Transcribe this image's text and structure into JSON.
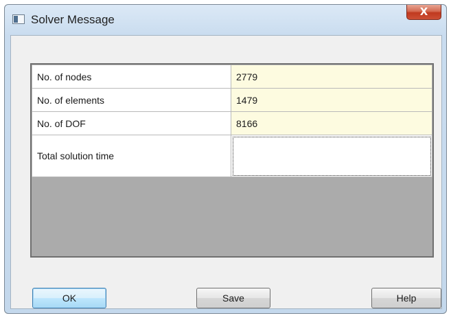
{
  "window": {
    "title": "Solver Message",
    "close_glyph": "X"
  },
  "grid": {
    "rows": [
      {
        "label": "No. of nodes",
        "value": "2779"
      },
      {
        "label": "No. of elements",
        "value": "1479"
      },
      {
        "label": "No. of DOF",
        "value": "8166"
      },
      {
        "label": "Total solution time",
        "value": ""
      }
    ]
  },
  "buttons": {
    "ok_label": "OK",
    "save_label": "Save",
    "help_label": "Help"
  },
  "colors": {
    "value_cell_bg": "#fdfbe0",
    "grid_background": "#ababab",
    "close_button": "#c0391f",
    "default_button_border": "#3c7fb1"
  },
  "icons": {
    "title_icon": "app-window-icon",
    "close_icon": "close-icon"
  }
}
